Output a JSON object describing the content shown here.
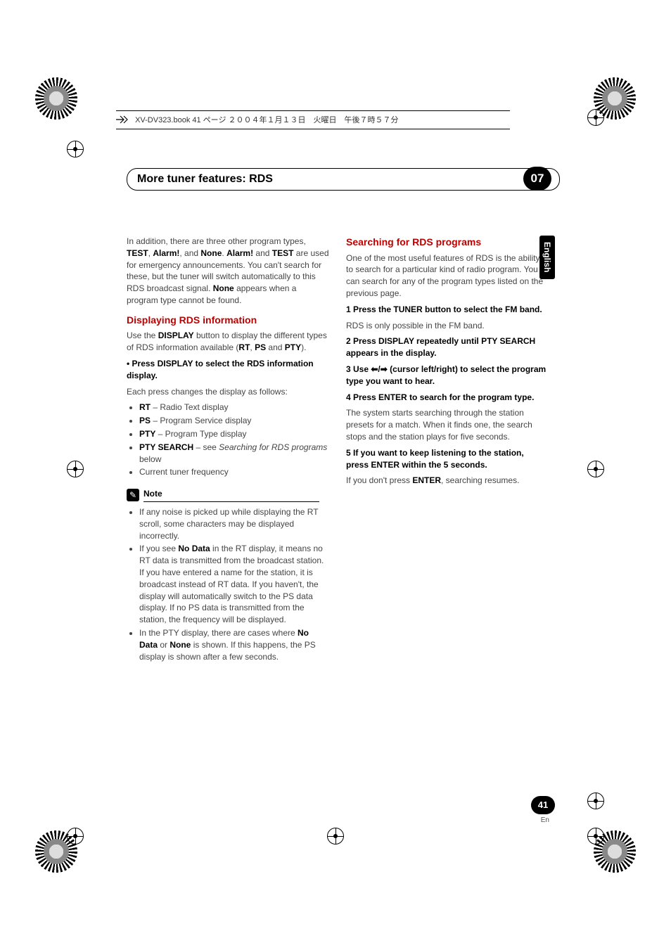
{
  "file_line": "XV-DV323.book  41 ページ  ２００４年１月１３日　火曜日　午後７時５７分",
  "header": {
    "title": "More tuner features: RDS",
    "chapter": "07"
  },
  "language_tab": "English",
  "page_number": "41",
  "page_lang": "En",
  "left": {
    "intro": {
      "p1a": "In addition, there are three other program types, ",
      "test": "TEST",
      "sep1": ", ",
      "alarm": "Alarm!",
      "sep2": ", and ",
      "none": "None",
      "sep3": ". ",
      "alarm2": "Alarm!",
      "sep4": " and ",
      "test2": "TEST",
      "p1b": " are used for emergency announcements. You can't search for these, but the tuner will switch automatically to this RDS broadcast signal. ",
      "none2": "None",
      "p1c": " appears when a program type cannot be found."
    },
    "h_display": "Displaying RDS information",
    "display_p1a": "Use the ",
    "display_kw": "DISPLAY",
    "display_p1b": " button to display the different types of RDS information available (",
    "display_rt": "RT",
    "display_sep1": ", ",
    "display_ps": "PS",
    "display_sep2": " and ",
    "display_pty": "PTY",
    "display_p1c": ").",
    "bullet_heading": "•    Press DISPLAY to select the RDS information display.",
    "each_press": "Each press changes the display as follows:",
    "list": {
      "rt_b": "RT",
      "rt_t": " – Radio Text display",
      "ps_b": "PS",
      "ps_t": " – Program Service display",
      "pty_b": "PTY",
      "pty_t": " – Program Type display",
      "search_b": "PTY SEARCH",
      "search_t": " – see ",
      "search_i": "Searching for RDS programs",
      "search_t2": " below",
      "freq": "Current tuner frequency"
    },
    "note_label": "Note",
    "note_icon": "✎",
    "notes": {
      "n1": "If any noise is picked up while displaying the RT scroll, some characters may be displayed incorrectly.",
      "n2a": "If you see ",
      "n2b": "No Data",
      "n2c": " in the RT display, it means no RT data is transmitted from the broadcast station. If you have entered a name for the station, it is broadcast instead of RT data. If you haven't, the display will automatically switch to the PS data display. If no PS data is transmitted from the station, the frequency will be displayed.",
      "n3a": "In the PTY display, there are cases where ",
      "n3b": "No Data",
      "n3c": " or ",
      "n3d": "None",
      "n3e": " is shown. If this happens, the PS display is shown after a few seconds."
    }
  },
  "right": {
    "h_search": "Searching for RDS programs",
    "intro": "One of the most useful features of RDS is the ability to search for a particular kind of radio program. You can search for any of the program types listed on the previous page.",
    "s1": "1    Press the TUNER button to select the FM band.",
    "s1t": "RDS is only possible in the FM band.",
    "s2": "2    Press DISPLAY repeatedly until PTY SEARCH appears in the display.",
    "s3a": "3    Use ",
    "s3arrows": "⬅/➡",
    "s3b": " (cursor left/right) to select the program type you want to hear.",
    "s4": "4    Press ENTER to search for the program type.",
    "s4t": "The system starts searching through the station presets for a match. When it finds one, the search stops and the station plays for five seconds.",
    "s5": "5    If you want to keep listening to the station, press ENTER within the 5 seconds.",
    "s5a": "If you don't press ",
    "s5b": "ENTER",
    "s5c": ", searching resumes."
  }
}
